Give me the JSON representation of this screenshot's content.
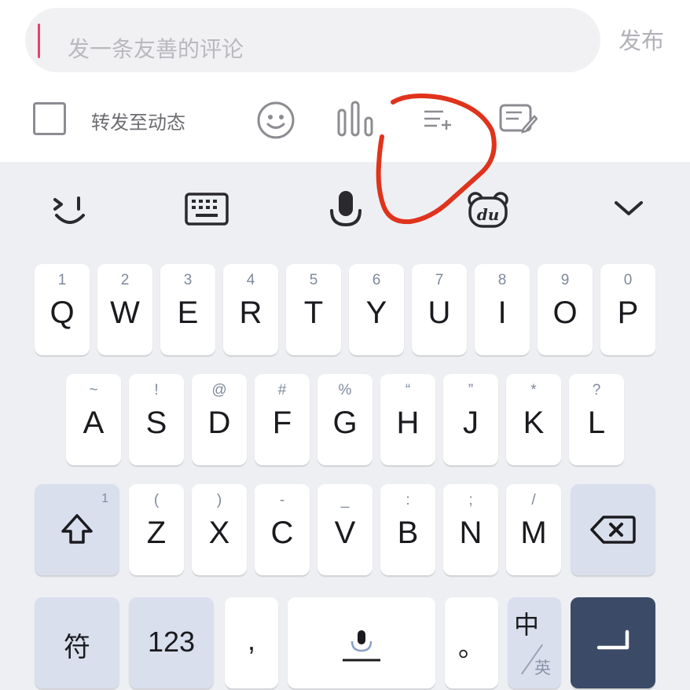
{
  "compose": {
    "placeholder": "发一条友善的评论",
    "publish_label": "发布",
    "forward_label": "转发至动态",
    "forward_checked": false
  },
  "icons": {
    "emoji": "smiley-face-icon",
    "audio": "audio-bars-icon",
    "list_add": "list-add-icon",
    "note": "note-edit-icon",
    "kb_emoji": "wink-face-icon",
    "kb_keyboard": "keyboard-icon",
    "kb_mic": "microphone-icon",
    "kb_brand": "du-bear-icon",
    "kb_collapse": "chevron-down-icon",
    "shift": "shift-arrow-icon",
    "backspace": "backspace-icon",
    "enter": "enter-return-icon",
    "space_mic": "space-mic-icon"
  },
  "keyboard": {
    "row1": [
      {
        "hint": "1",
        "label": "Q"
      },
      {
        "hint": "2",
        "label": "W"
      },
      {
        "hint": "3",
        "label": "E"
      },
      {
        "hint": "4",
        "label": "R"
      },
      {
        "hint": "5",
        "label": "T"
      },
      {
        "hint": "6",
        "label": "Y"
      },
      {
        "hint": "7",
        "label": "U"
      },
      {
        "hint": "8",
        "label": "I"
      },
      {
        "hint": "9",
        "label": "O"
      },
      {
        "hint": "0",
        "label": "P"
      }
    ],
    "row2": [
      {
        "hint": "~",
        "label": "A"
      },
      {
        "hint": "!",
        "label": "S"
      },
      {
        "hint": "@",
        "label": "D"
      },
      {
        "hint": "#",
        "label": "F"
      },
      {
        "hint": "%",
        "label": "G"
      },
      {
        "hint": "“",
        "label": "H"
      },
      {
        "hint": "”",
        "label": "J"
      },
      {
        "hint": "*",
        "label": "K"
      },
      {
        "hint": "?",
        "label": "L"
      }
    ],
    "row3": [
      {
        "hint": "(",
        "label": "Z"
      },
      {
        "hint": ")",
        "label": "X"
      },
      {
        "hint": "-",
        "label": "C"
      },
      {
        "hint": "_",
        "label": "V"
      },
      {
        "hint": ":",
        "label": "B"
      },
      {
        "hint": ";",
        "label": "N"
      },
      {
        "hint": "/",
        "label": "M"
      }
    ],
    "shift_hint": "1",
    "symbols_label": "符",
    "numbers_label": "123",
    "comma_label": ",",
    "period_label": "。",
    "lang_primary": "中",
    "lang_secondary": "英"
  },
  "colors": {
    "enter_key": "#3b4a66",
    "annotation": "#e0331c",
    "caret": "#e3436b"
  }
}
